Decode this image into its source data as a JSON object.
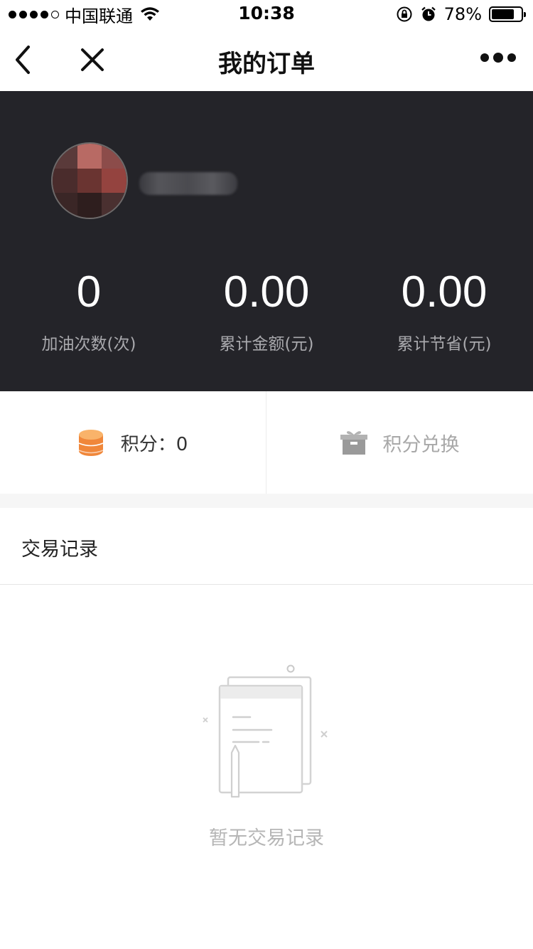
{
  "status_bar": {
    "carrier": "中国联通",
    "time": "10:38",
    "battery_percent": "78%",
    "battery_level": 0.78,
    "signal_bars_filled": 4,
    "signal_bars_total": 5
  },
  "nav": {
    "title": "我的订单",
    "back_icon": "chevron-left-icon",
    "close_icon": "close-icon",
    "more_icon": "more-dots-icon"
  },
  "profile": {
    "stats": [
      {
        "value": "0",
        "label": "加油次数(次)"
      },
      {
        "value": "0.00",
        "label": "累计金额(元)"
      },
      {
        "value": "0.00",
        "label": "累计节省(元)"
      }
    ]
  },
  "points": {
    "label": "积分：0",
    "exchange_label": "积分兑换",
    "coin_icon": "coin-stack-icon",
    "gift_icon": "gift-box-icon",
    "accent_color": "#f39a3e"
  },
  "transactions": {
    "title": "交易记录",
    "empty_text": "暂无交易记录",
    "empty_icon": "empty-document-icon"
  },
  "colors": {
    "header_bg": "#242429",
    "stat_label": "#a9a9ad"
  }
}
